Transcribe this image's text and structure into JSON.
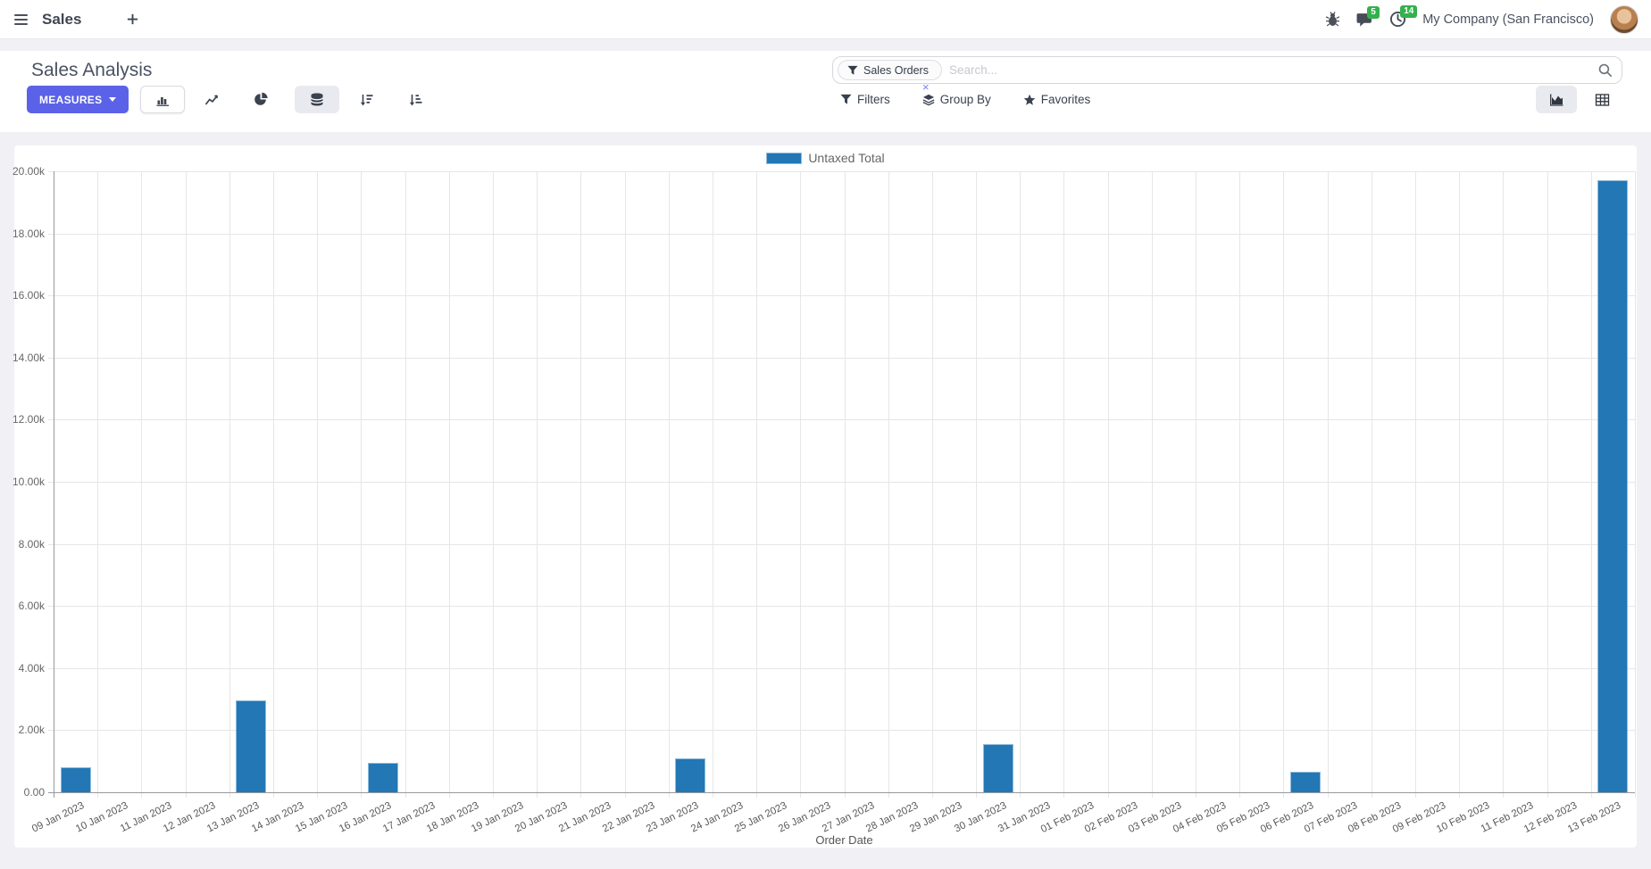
{
  "topbar": {
    "app_name": "Sales",
    "message_count": "5",
    "activity_count": "14",
    "company": "My Company (San Francisco)"
  },
  "control_panel": {
    "title": "Sales Analysis",
    "measures_label": "MEASURES",
    "filters_label": "Filters",
    "group_by_label": "Group By",
    "favorites_label": "Favorites",
    "search": {
      "facet_label": "Sales Orders",
      "facet_remove": "×",
      "placeholder": "Search..."
    }
  },
  "colors": {
    "primary_button": "#5b62e7",
    "badge_green": "#33b14c",
    "bar_blue": "#2277b4"
  },
  "chart_data": {
    "type": "bar",
    "title": "",
    "legend_position": "top",
    "grid": true,
    "xlabel": "Order Date",
    "ylabel": "",
    "ylim": [
      0,
      20000
    ],
    "ytick_step": 2000,
    "ytick_labels": [
      "0.00",
      "2.00k",
      "4.00k",
      "6.00k",
      "8.00k",
      "10.00k",
      "12.00k",
      "14.00k",
      "16.00k",
      "18.00k",
      "20.00k"
    ],
    "categories": [
      "09 Jan 2023",
      "10 Jan 2023",
      "11 Jan 2023",
      "12 Jan 2023",
      "13 Jan 2023",
      "14 Jan 2023",
      "15 Jan 2023",
      "16 Jan 2023",
      "17 Jan 2023",
      "18 Jan 2023",
      "19 Jan 2023",
      "20 Jan 2023",
      "21 Jan 2023",
      "22 Jan 2023",
      "23 Jan 2023",
      "24 Jan 2023",
      "25 Jan 2023",
      "26 Jan 2023",
      "27 Jan 2023",
      "28 Jan 2023",
      "29 Jan 2023",
      "30 Jan 2023",
      "31 Jan 2023",
      "01 Feb 2023",
      "02 Feb 2023",
      "03 Feb 2023",
      "04 Feb 2023",
      "05 Feb 2023",
      "06 Feb 2023",
      "07 Feb 2023",
      "08 Feb 2023",
      "09 Feb 2023",
      "10 Feb 2023",
      "11 Feb 2023",
      "12 Feb 2023",
      "13 Feb 2023"
    ],
    "series": [
      {
        "name": "Untaxed Total",
        "color": "#2277b4",
        "values": [
          800,
          0,
          0,
          0,
          2950,
          0,
          0,
          950,
          0,
          0,
          0,
          0,
          0,
          0,
          1100,
          0,
          0,
          0,
          0,
          0,
          0,
          1550,
          0,
          0,
          0,
          0,
          0,
          0,
          660,
          0,
          0,
          0,
          0,
          0,
          0,
          19700
        ]
      }
    ]
  }
}
